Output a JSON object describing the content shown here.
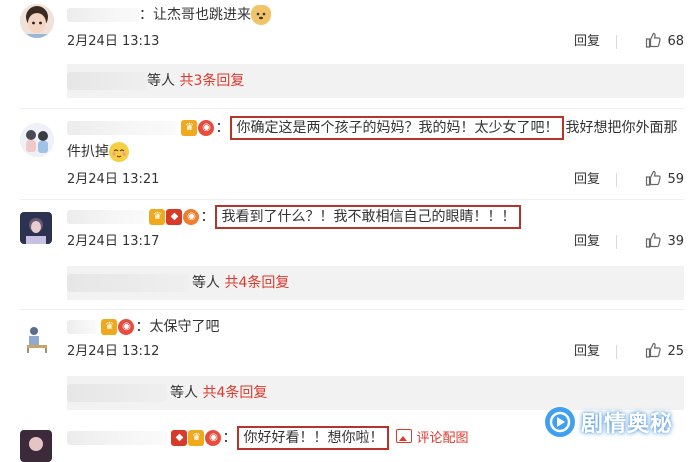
{
  "comments": [
    {
      "text_before": "：让杰哥也跳进来",
      "time": "2月24日 13:13",
      "reply_label": "回复",
      "likes": "68",
      "sub_reply": {
        "suffix": "等人",
        "more": "共3条回复"
      }
    },
    {
      "highlight": "你确定这是两个孩子的妈妈？我的妈！太少女了吧！",
      "text_after": "我好想把你外面那件扒掉",
      "time": "2月24日 13:21",
      "reply_label": "回复",
      "likes": "59"
    },
    {
      "highlight": "我看到了什么？！我不敢相信自己的眼睛！！！",
      "time": "2月24日 13:17",
      "reply_label": "回复",
      "likes": "39",
      "sub_reply": {
        "suffix": "等人",
        "more": "共4条回复"
      }
    },
    {
      "text_before": "：太保守了吧",
      "time": "2月24日 13:12",
      "reply_label": "回复",
      "likes": "25",
      "sub_reply": {
        "suffix": "等人",
        "more": "共4条回复"
      }
    },
    {
      "highlight": "你好好看！！想你啦！",
      "pic_link": "评论配图"
    }
  ],
  "colon": "：",
  "watermark": {
    "text": "剧情奥秘"
  },
  "colors": {
    "highlight_border": "#b8342a",
    "link_red": "#e2372b",
    "subreply_bg": "#f2f2f2"
  },
  "icons": [
    "thumbs-up-icon",
    "image-icon",
    "emoji-icon",
    "vip-badge-icon",
    "logo-icon"
  ]
}
